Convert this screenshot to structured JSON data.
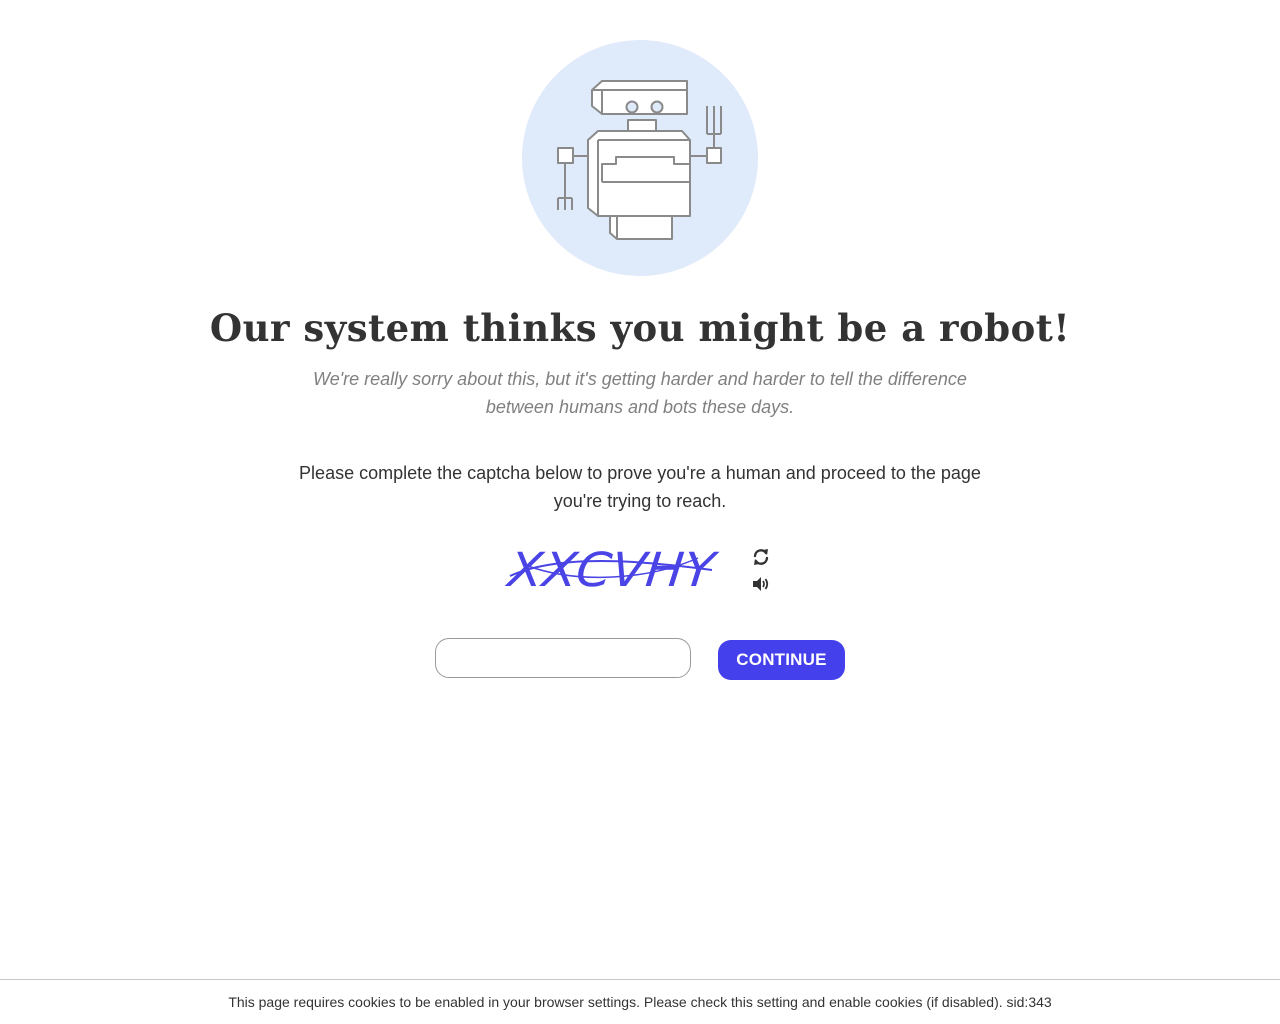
{
  "hero": {
    "icon": "robot-illustration",
    "circle_color": "#dfeafb"
  },
  "title": "Our system thinks you might be a robot!",
  "subtitle": "We're really sorry about this, but it's getting harder and harder to tell the difference between humans and bots these days.",
  "instructions": "Please complete the captcha below to prove you're a human and proceed to the page you're trying to reach.",
  "captcha": {
    "text": "XXCVHY",
    "text_color": "#4a44e6",
    "refresh_icon": "refresh-icon",
    "audio_icon": "speaker-icon",
    "input_value": "",
    "input_placeholder": ""
  },
  "continue_label": "CONTINUE",
  "accent_color": "#4440ec",
  "footer": "This page requires cookies to be enabled in your browser settings. Please check this setting and enable cookies (if disabled). sid:343"
}
